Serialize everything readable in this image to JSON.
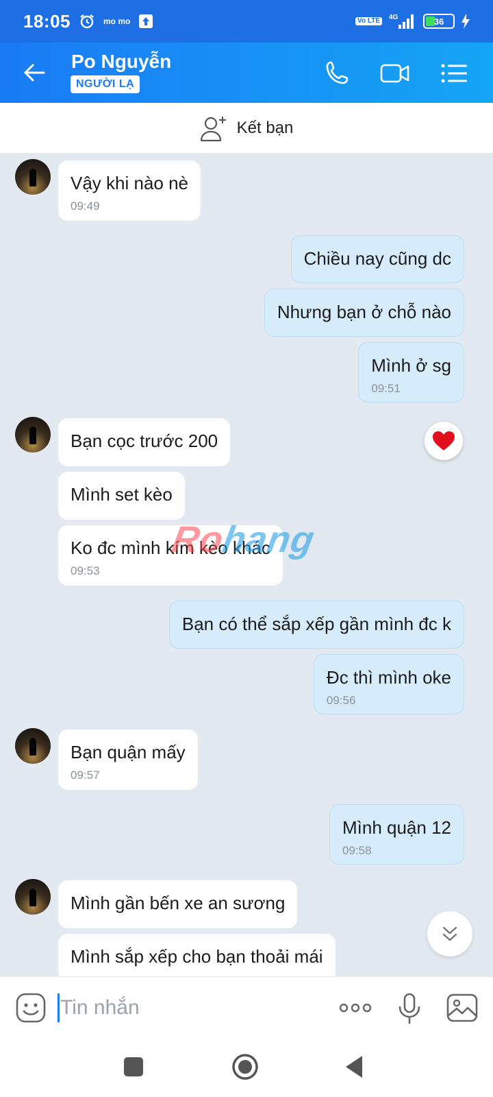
{
  "status_bar": {
    "time": "18:05",
    "momo_text": "mo mo",
    "volte": "Vo LTE",
    "network": "4G",
    "battery": "36"
  },
  "header": {
    "name": "Po Nguyễn",
    "badge": "NGƯỜI LẠ",
    "icons": [
      "back-arrow-icon",
      "phone-icon",
      "video-call-icon",
      "menu-icon"
    ]
  },
  "add_friend": {
    "label": "Kết bạn"
  },
  "messages": [
    {
      "side": "in",
      "text": "Vậy khi nào nè",
      "time": "09:49"
    },
    {
      "side": "out",
      "text": "Chiều nay cũng dc",
      "time": ""
    },
    {
      "side": "out",
      "text": "Nhưng bạn ở chỗ nào",
      "time": ""
    },
    {
      "side": "out",
      "text": "Mình ở sg",
      "time": "09:51"
    },
    {
      "side": "in",
      "text": "Bạn cọc trước 200",
      "time": ""
    },
    {
      "side": "in",
      "text": "Mình set kèo",
      "time": ""
    },
    {
      "side": "in",
      "text": "Ko đc mình kím kèo khác",
      "time": "09:53"
    },
    {
      "side": "out",
      "text": "Bạn có thể sắp xếp gần mình đc k",
      "time": ""
    },
    {
      "side": "out",
      "text": "Đc thì mình oke",
      "time": "09:56"
    },
    {
      "side": "in",
      "text": "Bạn quận mấy",
      "time": "09:57"
    },
    {
      "side": "out",
      "text": "Mình quận 12",
      "time": "09:58"
    },
    {
      "side": "in",
      "text": "Mình gần bến xe an sương",
      "time": ""
    },
    {
      "side": "in",
      "text": "Mình sắp xếp cho bạn thoải mái",
      "time": ""
    }
  ],
  "reaction": {
    "icon": "heart-icon",
    "color": "#e0101e"
  },
  "watermark": {
    "part1": "Ro",
    "part2": "hang"
  },
  "input": {
    "placeholder": "Tin nhắn"
  },
  "colors": {
    "accent": "#1a7bf5",
    "outgoing_bubble": "#d6ecfb",
    "chat_bg": "#e2e9f1"
  }
}
